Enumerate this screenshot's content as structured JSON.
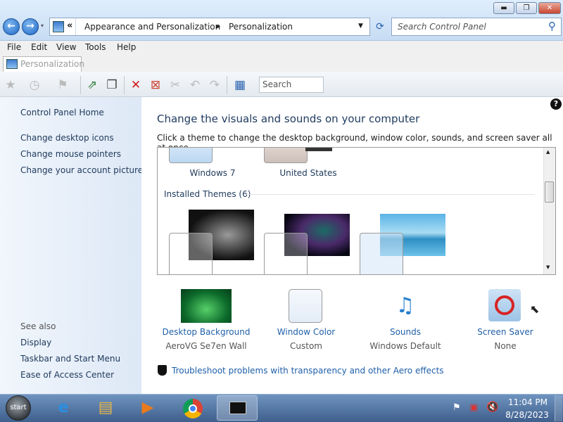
{
  "window": {
    "controls": {
      "minimize": "▬",
      "maximize": "❐",
      "close": "✕"
    }
  },
  "nav": {
    "back": "←",
    "forward": "→",
    "breadcrumb_overflow": "«",
    "breadcrumb": [
      "Appearance and Personalization",
      "Personalization"
    ],
    "search_placeholder": "Search Control Panel"
  },
  "menu": [
    "File",
    "Edit",
    "View",
    "Tools",
    "Help"
  ],
  "tab": {
    "label": "Personalization"
  },
  "toolbar": {
    "search_placeholder": "Search"
  },
  "sidebar": {
    "home": "Control Panel Home",
    "links": [
      "Change desktop icons",
      "Change mouse pointers",
      "Change your account picture"
    ],
    "see_also_title": "See also",
    "see_also": [
      "Display",
      "Taskbar and Start Menu",
      "Ease of Access Center"
    ]
  },
  "main": {
    "title": "Change the visuals and sounds on your computer",
    "subtitle": "Click a theme to change the desktop background, window color, sounds, and screen saver all at once.",
    "top_themes": [
      "Windows 7",
      "United States"
    ],
    "installed_header": "Installed Themes (6)",
    "help": "?"
  },
  "settings": [
    {
      "title": "Desktop Background",
      "value": "AeroVG Se7en Wall"
    },
    {
      "title": "Window Color",
      "value": "Custom"
    },
    {
      "title": "Sounds",
      "value": "Windows Default"
    },
    {
      "title": "Screen Saver",
      "value": "None"
    }
  ],
  "troubleshoot": "Troubleshoot problems with transparency and other Aero effects",
  "taskbar": {
    "start_label": "start",
    "time": "11:04 PM",
    "date": "8/28/2023"
  },
  "colors": {
    "link": "#1e5fa8",
    "title": "#1e3a5f",
    "accent": "#3f5f8c"
  }
}
